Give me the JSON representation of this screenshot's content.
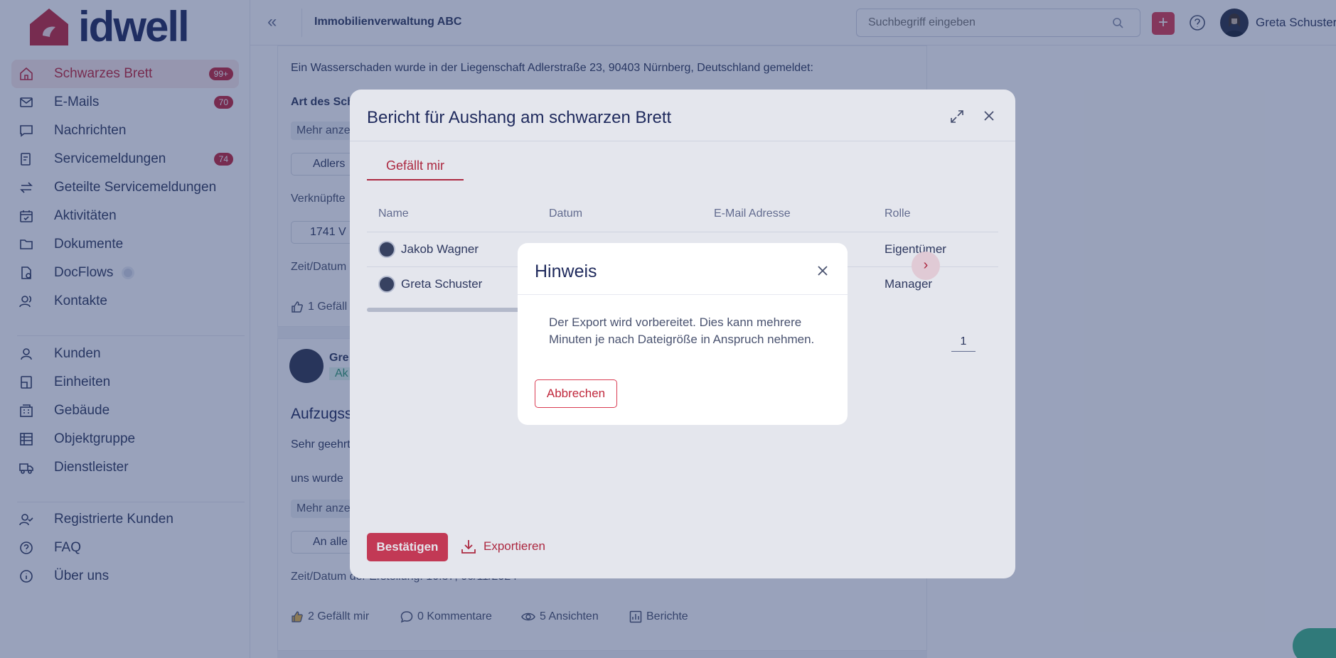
{
  "app": {
    "logo_text": "idwell",
    "org_name": "Immobilienverwaltung ABC"
  },
  "colors": {
    "accent": "#d93b52",
    "brand_dark": "#1f2a5c",
    "overlay": "#203468"
  },
  "sidebar": {
    "items": [
      {
        "label": "Schwarzes Brett",
        "badge": "99+",
        "icon": "home-icon",
        "active": true
      },
      {
        "label": "E-Mails",
        "badge": "70",
        "icon": "mail-icon"
      },
      {
        "label": "Nachrichten",
        "icon": "chat-icon"
      },
      {
        "label": "Servicemeldungen",
        "badge": "74",
        "icon": "service-icon"
      },
      {
        "label": "Geteilte Servicemeldungen",
        "icon": "transfer-icon"
      },
      {
        "label": "Aktivitäten",
        "icon": "calendar-check-icon"
      },
      {
        "label": "Dokumente",
        "icon": "folder-icon"
      },
      {
        "label": "DocFlows",
        "icon": "docflow-icon"
      },
      {
        "label": "Kontakte",
        "icon": "contacts-icon"
      },
      {
        "label": "Kunden",
        "icon": "user-icon"
      },
      {
        "label": "Einheiten",
        "icon": "unit-icon"
      },
      {
        "label": "Gebäude",
        "icon": "building-icon"
      },
      {
        "label": "Objektgruppe",
        "icon": "object-group-icon"
      },
      {
        "label": "Dienstleister",
        "icon": "truck-icon"
      },
      {
        "label": "Registrierte Kunden",
        "icon": "user-check-icon"
      },
      {
        "label": "FAQ",
        "icon": "question-icon"
      },
      {
        "label": "Über uns",
        "icon": "info-icon"
      }
    ]
  },
  "topbar": {
    "search_placeholder": "Suchbegriff eingeben",
    "user_name": "Greta Schuster"
  },
  "feed": {
    "post1": {
      "text": "Ein Wasserschaden wurde in der Liegenschaft Adlerstraße 23, 90403 Nürnberg, Deutschland gemeldet:",
      "label_art": "Art des Sch",
      "more": "Mehr anze",
      "chip_property": "Adlers",
      "linked_label": "Verknüpfte",
      "chip_unit": "1741 V",
      "created": "Zeit/Datum",
      "likes": "1 Gefäll"
    },
    "post2": {
      "author": "Gre",
      "role": "Ak",
      "title": "Aufzugss",
      "greeting": "Sehr geehrt",
      "line2": "uns wurde",
      "more": "Mehr anze",
      "chip_audience": "An alle",
      "created": "Zeit/Datum der Erstellung: 10:37, 06/11/2024",
      "likes": "2 Gefällt mir",
      "comments": "0 Kommentare",
      "views": "5 Ansichten",
      "reports": "Berichte"
    }
  },
  "report_modal": {
    "title": "Bericht für Aushang am schwarzen Brett",
    "tab": "Gefällt mir",
    "columns": [
      "Name",
      "Datum",
      "E-Mail Adresse",
      "Rolle"
    ],
    "rows": [
      {
        "name": "Jakob Wagner",
        "role": "Eigentümer"
      },
      {
        "name": "Greta Schuster",
        "role": "Manager"
      }
    ],
    "page": "1",
    "confirm": "Bestätigen",
    "export": "Exportieren"
  },
  "hinweis": {
    "title": "Hinweis",
    "message": "Der Export wird vorbereitet. Dies kann mehrere Minuten je nach Dateigröße in Anspruch nehmen.",
    "cancel": "Abbrechen"
  }
}
